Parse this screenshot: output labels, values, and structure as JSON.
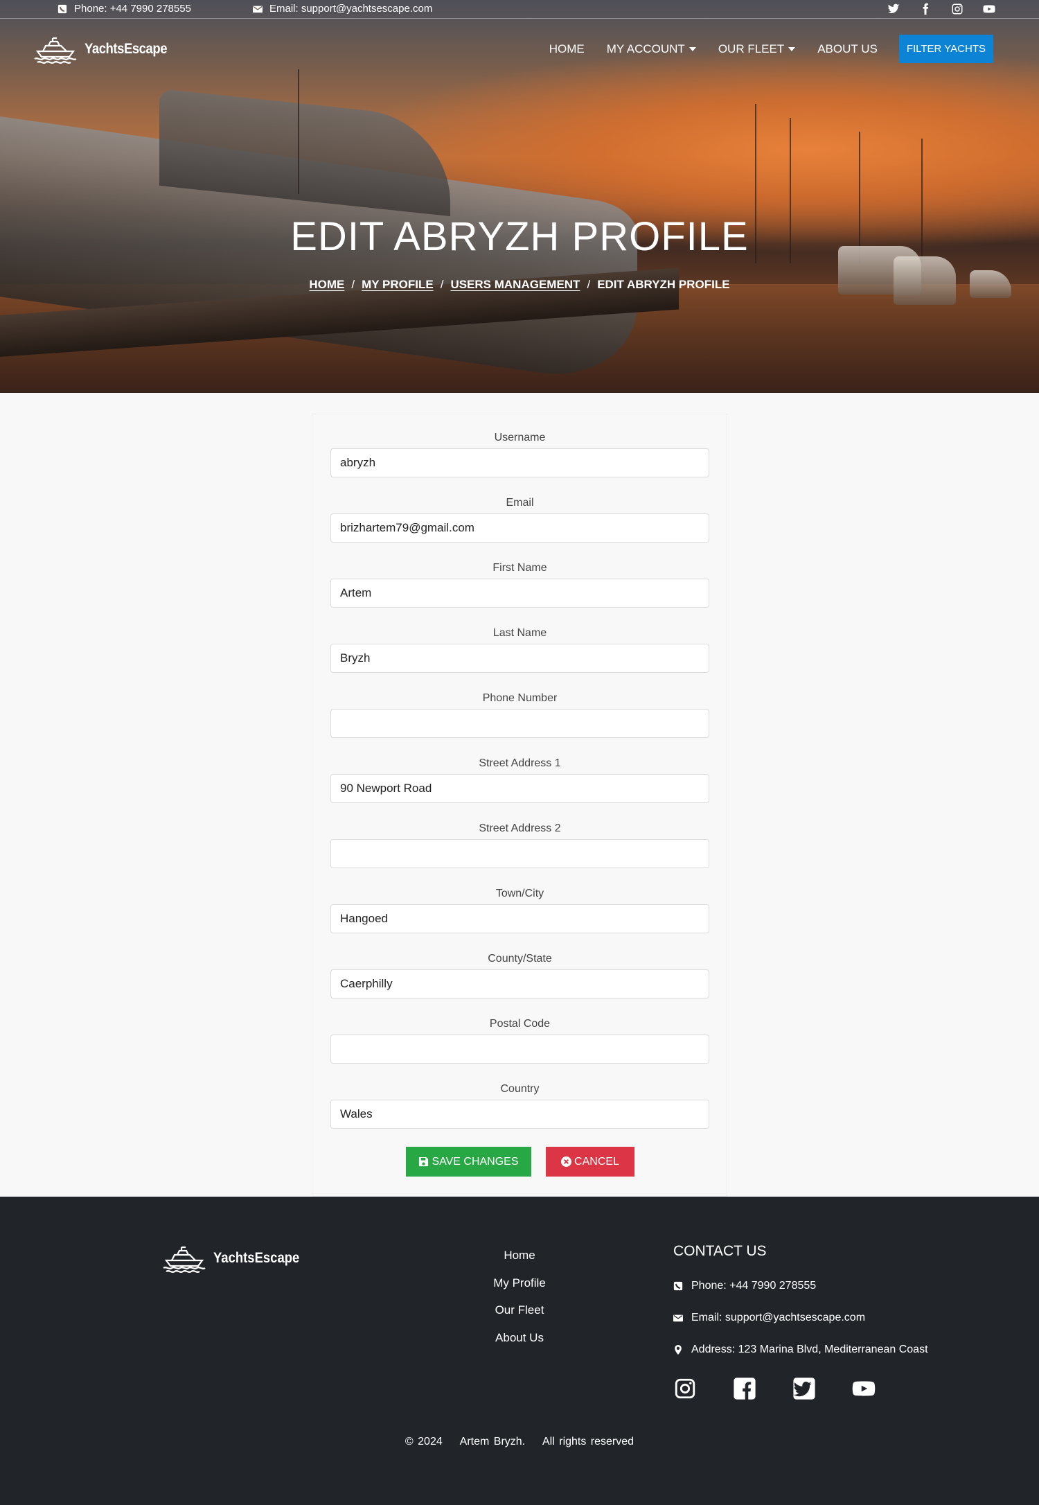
{
  "topbar": {
    "phone": "Phone: +44 7990 278555",
    "email": "Email: support@yachtsescape.com",
    "socials": [
      "twitter-icon",
      "facebook-icon",
      "instagram-icon",
      "youtube-icon"
    ]
  },
  "brand": {
    "name": "YachtsEscape"
  },
  "nav": {
    "items": [
      {
        "label": "HOME",
        "dropdown": false
      },
      {
        "label": "MY ACCOUNT",
        "dropdown": true
      },
      {
        "label": "OUR FLEET",
        "dropdown": true
      },
      {
        "label": "ABOUT US",
        "dropdown": false
      }
    ],
    "cta": "FILTER YACHTS"
  },
  "hero": {
    "title": "EDIT ABRYZH PROFILE",
    "breadcrumb": [
      "HOME",
      "MY PROFILE",
      "USERS MANAGEMENT",
      "EDIT ABRYZH PROFILE"
    ]
  },
  "form": {
    "fields": [
      {
        "label": "Username",
        "value": "abryzh"
      },
      {
        "label": "Email",
        "value": "brizhartem79@gmail.com"
      },
      {
        "label": "First Name",
        "value": "Artem"
      },
      {
        "label": "Last Name",
        "value": "Bryzh"
      },
      {
        "label": "Phone Number",
        "value": ""
      },
      {
        "label": "Street Address 1",
        "value": "90 Newport Road"
      },
      {
        "label": "Street Address 2",
        "value": ""
      },
      {
        "label": "Town/City",
        "value": "Hangoed"
      },
      {
        "label": "County/State",
        "value": "Caerphilly"
      },
      {
        "label": "Postal Code",
        "value": ""
      },
      {
        "label": "Country",
        "value": "Wales"
      }
    ],
    "save_label": "SAVE CHANGES",
    "cancel_label": "CANCEL",
    "colors": {
      "save": "#28a745",
      "cancel": "#dc3545"
    }
  },
  "footer": {
    "brand": "YachtsEscape",
    "links": [
      "Home",
      "My Profile",
      "Our Fleet",
      "About Us"
    ],
    "contact_title": "CONTACT US",
    "phone": "Phone: +44 7990 278555",
    "email": "Email: support@yachtsescape.com",
    "address": "Address: 123 Marina Blvd, Mediterranean Coast",
    "socials": [
      "instagram-icon",
      "facebook-square-icon",
      "twitter-square-icon",
      "youtube-icon"
    ],
    "copyright": "© 2024    Artem Bryzh.    All rights reserved"
  },
  "colors": {
    "accent": "#0d83d6",
    "footer_bg": "#212529",
    "page_bg": "#f8f8f8"
  }
}
